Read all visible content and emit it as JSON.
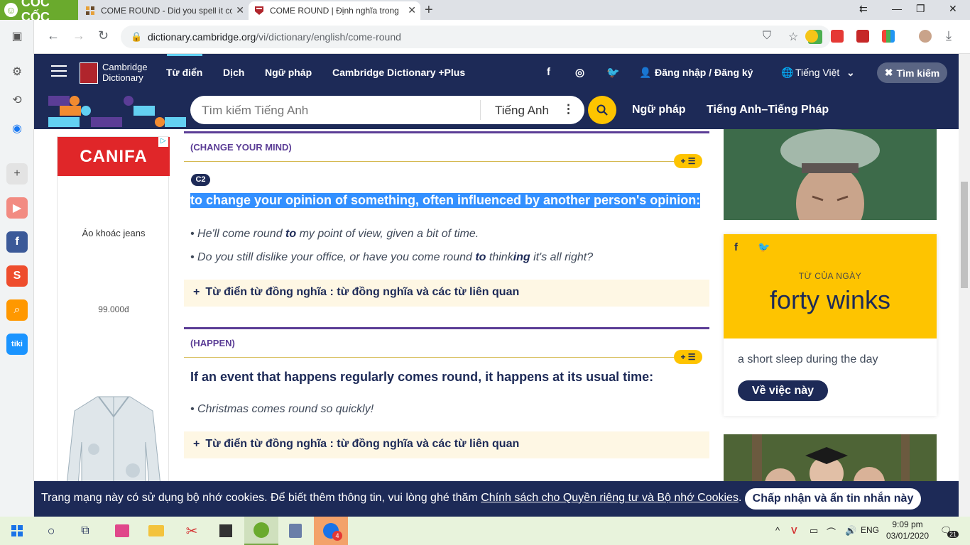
{
  "browser": {
    "brand": "CỐC CỐC",
    "tabs": [
      {
        "title": "COME ROUND - Did you spell it correctly?"
      },
      {
        "title": "COME ROUND | Định nghĩa trong Từ điển tiếng Anh Cambridge"
      }
    ],
    "url_domain": "dictionary.cambridge.org",
    "url_path": "/vi/dictionary/english/come-round"
  },
  "site": {
    "logo_line1": "Cambridge",
    "logo_line2": "Dictionary",
    "nav": [
      "Từ điển",
      "Dịch",
      "Ngữ pháp",
      "Cambridge Dictionary +Plus"
    ],
    "login": "Đăng nhập / Đăng ký",
    "language": "Tiếng Việt",
    "search_toggle": "Tìm kiếm",
    "search_placeholder": "Tìm kiếm Tiếng Anh",
    "search_dictionary": "Tiếng Anh",
    "links": [
      "Ngữ pháp",
      "Tiếng Anh–Tiếng Pháp"
    ]
  },
  "ad": {
    "brand": "CANIFA",
    "product": "Áo khoác jeans",
    "price": "99.000đ"
  },
  "senses": [
    {
      "guideword": "(CHANGE YOUR MIND)",
      "level": "C2",
      "definition": "to change your opinion of something, often influenced by another person's opinion:",
      "examples": [
        {
          "pre": "He'll come round ",
          "bold": "to",
          "post": " my point of view, given a bit of time.",
          "bold2": "",
          "post2": ""
        },
        {
          "pre": "Do you still dislike your office, or have you come round ",
          "bold": "to",
          "post": " think",
          "bold2": "ing",
          "post2": " it's all right?"
        }
      ],
      "thesaurus": "Từ điển từ đồng nghĩa : từ đồng nghĩa và các từ liên quan"
    },
    {
      "guideword": "(HAPPEN)",
      "level": "",
      "definition": "If an event that happens regularly comes round, it happens at its usual time:",
      "examples": [
        {
          "pre": "Christmas comes round so quickly!",
          "bold": "",
          "post": "",
          "bold2": "",
          "post2": ""
        }
      ],
      "thesaurus": "Từ điển từ đồng nghĩa : từ đồng nghĩa và các từ liên quan"
    }
  ],
  "word_of_the_day": {
    "label": "TỪ CỦA NGÀY",
    "word": "forty winks",
    "definition": "a short sleep during the day",
    "button": "Về việc này"
  },
  "cookie": {
    "text": "Trang mạng này có sử dụng bộ nhớ cookies. Để biết thêm thông tin, vui lòng ghé thăm ",
    "link": "Chính sách cho Quyền riêng tư và Bộ nhớ Cookies",
    "suffix": ".",
    "button": "Chấp nhận và ẩn tin nhắn này"
  },
  "taskbar": {
    "language": "ENG",
    "time": "9:09 pm",
    "date": "03/01/2020",
    "notifications": "21",
    "badge": "4"
  },
  "colors": {
    "navy": "#1d2a57",
    "yellow": "#fec400",
    "purple": "#5b3d96",
    "highlight": "#3390ff"
  }
}
